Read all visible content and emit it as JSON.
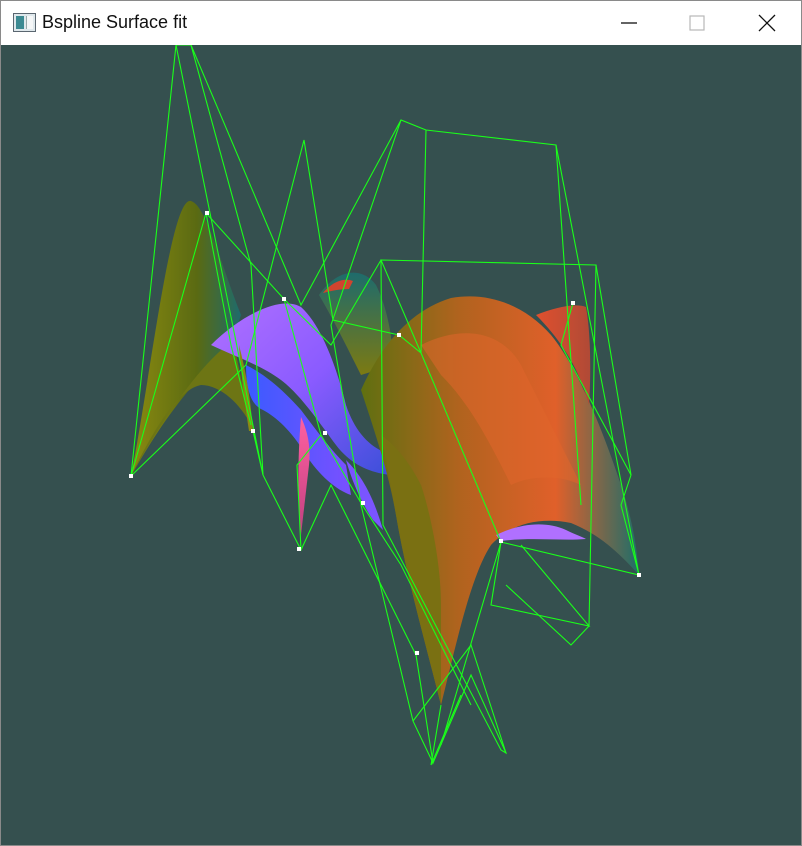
{
  "window": {
    "title": "Bspline Surface fit",
    "controls": {
      "minimize_icon": "minimize-icon",
      "maximize_icon": "maximize-icon",
      "close_icon": "close-icon"
    }
  },
  "viewport": {
    "background_color": "#35504f",
    "control_net_color": "#1aff1a",
    "control_point_color": "#ffffff",
    "surface_colors": [
      "#7a7a10",
      "#ff5a30",
      "#9a5bff",
      "#4b6bff",
      "#ff77b0",
      "#1f6f6a"
    ]
  }
}
